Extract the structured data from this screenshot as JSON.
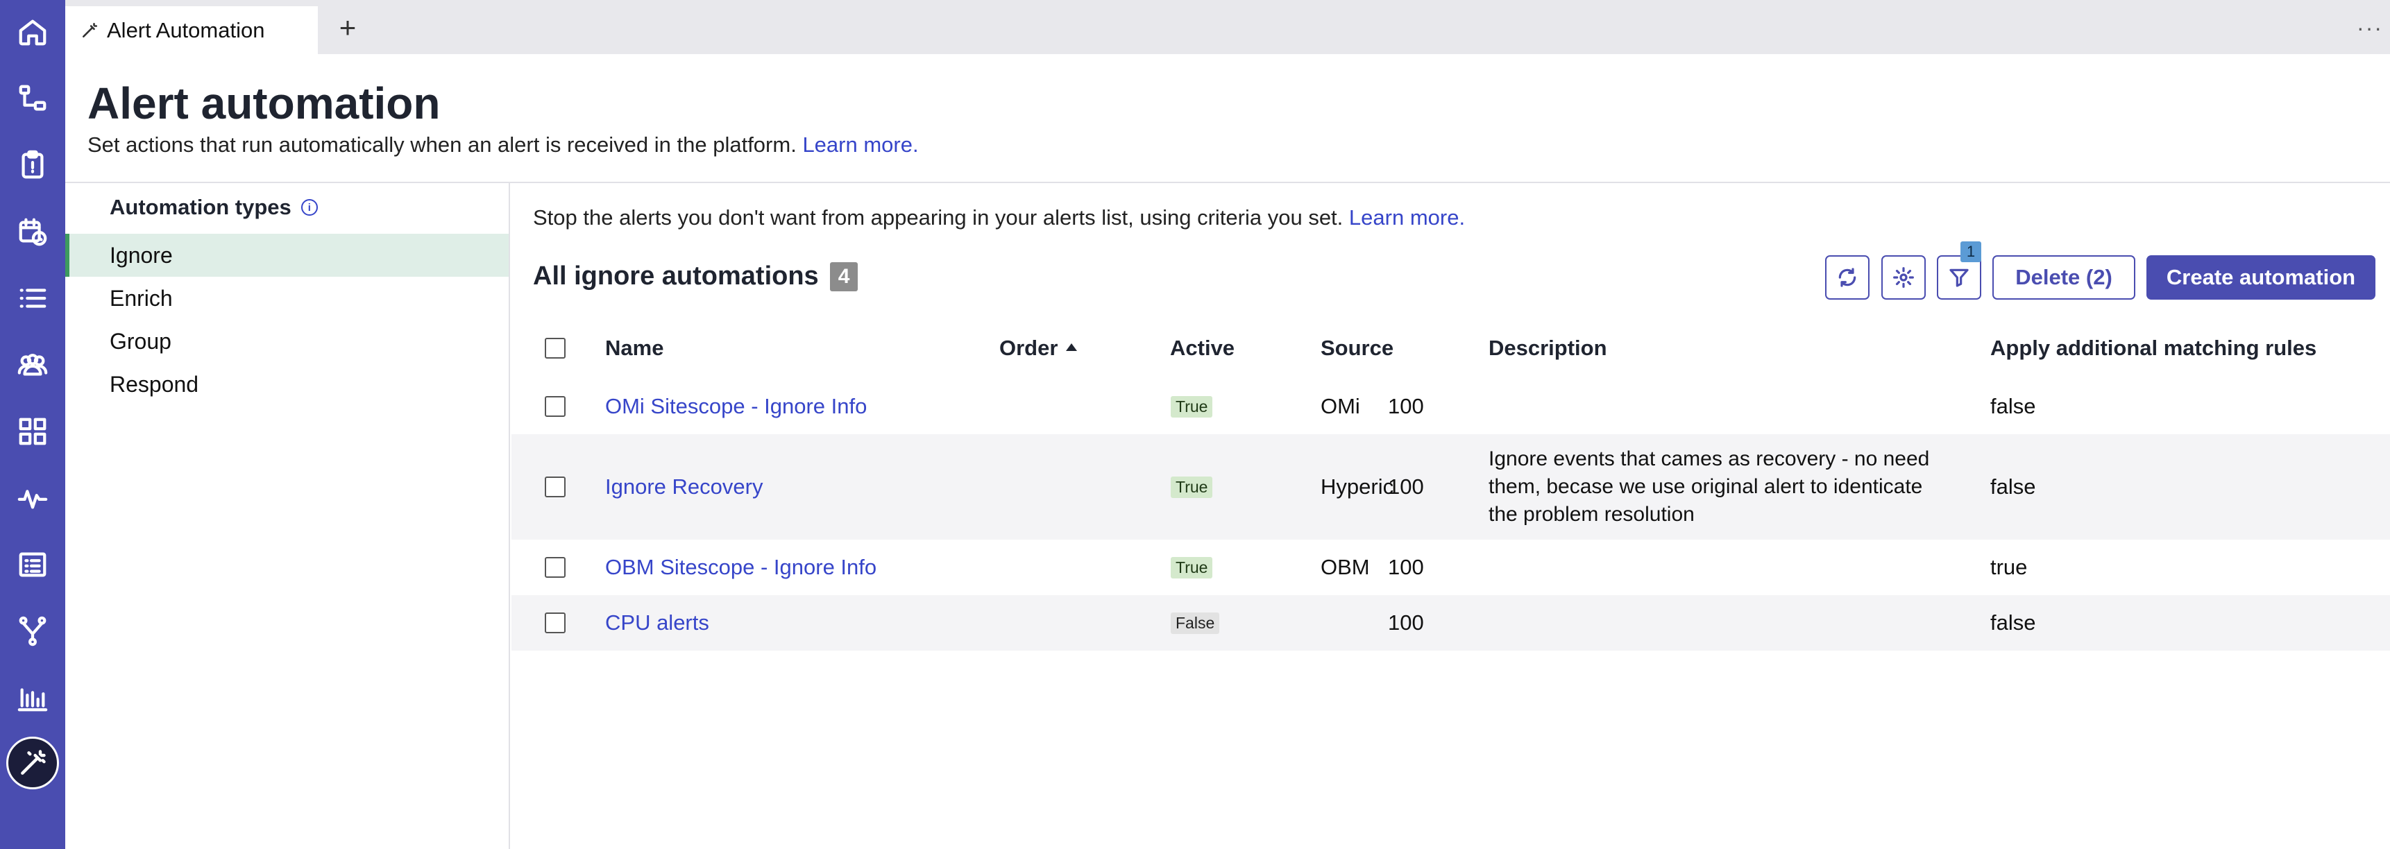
{
  "nav_rail": {
    "icons": [
      "home-icon",
      "hierarchy-icon",
      "clipboard-icon",
      "calendar-clock-icon",
      "list-icon",
      "team-icon",
      "grid-icon",
      "pulse-icon",
      "report-icon",
      "branch-icon",
      "bar-chart-icon",
      "wand-icon"
    ],
    "active": "wand-icon",
    "colors": {
      "background": "#4a4db0",
      "active_bg": "#1b1d3a"
    }
  },
  "tabs": {
    "active_label": "Alert Automation",
    "add_label": "+",
    "more_label": "···"
  },
  "header": {
    "title": "Alert automation",
    "subtitle": "Set actions that run automatically when an alert is received in the platform.",
    "learn_more": "Learn more."
  },
  "sidebar": {
    "heading": "Automation types",
    "info_glyph": "i",
    "items": [
      {
        "label": "Ignore",
        "active": true
      },
      {
        "label": "Enrich",
        "active": false
      },
      {
        "label": "Group",
        "active": false
      },
      {
        "label": "Respond",
        "active": false
      }
    ]
  },
  "main": {
    "description": "Stop the alerts you don't want from appearing in your alerts list, using criteria you set.",
    "learn_more": "Learn more.",
    "section_title": "All ignore automations",
    "count": "4",
    "filter_count": "1",
    "delete_label": "Delete (2)",
    "create_label": "Create automation"
  },
  "table": {
    "columns": [
      "Name",
      "Order",
      "Active",
      "Source",
      "Description",
      "Apply additional matching rules"
    ],
    "sorted_column": "Order",
    "sort_direction": "ascending",
    "rows": [
      {
        "name": "OMi Sitescope - Ignore Info",
        "order": "100",
        "active": "True",
        "source": "OMi",
        "description": "",
        "apply": "false"
      },
      {
        "name": "Ignore Recovery",
        "order": "100",
        "active": "True",
        "source": "Hyperic",
        "description": "Ignore events that cames as recovery - no need them, becase we use original alert to identicate the problem resolution",
        "apply": "false"
      },
      {
        "name": "OBM Sitescope - Ignore Info",
        "order": "100",
        "active": "True",
        "source": "OBM",
        "description": "",
        "apply": "true"
      },
      {
        "name": "CPU alerts",
        "order": "100",
        "active": "False",
        "source": "",
        "description": "",
        "apply": "false"
      }
    ]
  },
  "colors": {
    "accent": "#4a4db0",
    "link": "#3645c9",
    "active_sidebar_bg": "#dfeee7",
    "active_sidebar_border": "#3d9a5f",
    "true_pill": "#d4e9cc",
    "false_pill": "#e2e2e2"
  }
}
